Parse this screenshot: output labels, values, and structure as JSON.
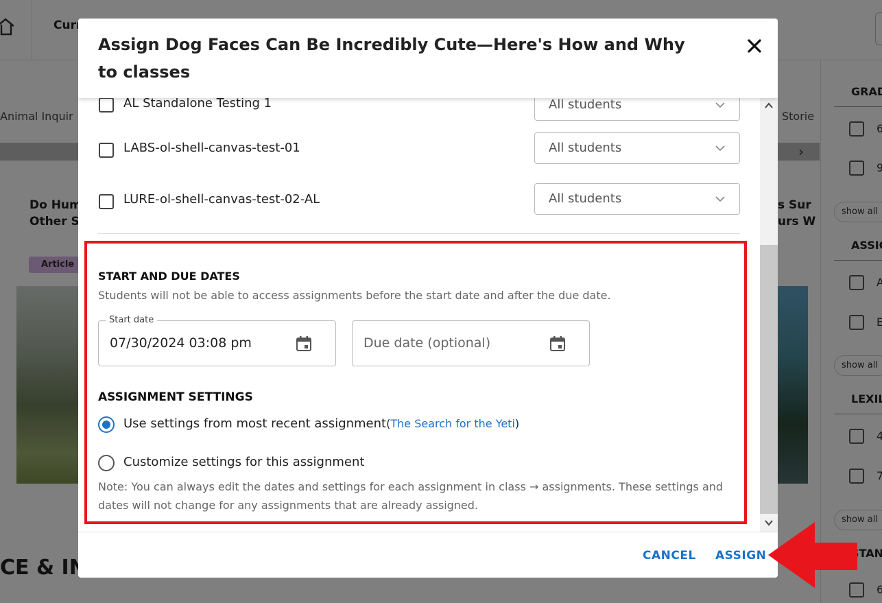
{
  "background": {
    "nav_current": "Curr",
    "tabs_left": "Animal Inquir",
    "tabs_right": "Storie",
    "card_left_title_line1": "Do Hum",
    "card_left_title_line2": "Other S",
    "article_badge": "Article",
    "card_right_title_line1": "s Sur",
    "card_right_title_line2": "urs W",
    "bottom_heading": "CE & INN",
    "sidebar": {
      "grade_title": "GRAD",
      "grade_values": [
        "6",
        "9"
      ],
      "assign_title": "ASSIG",
      "assign_values": [
        "A",
        "E"
      ],
      "lexile_title": "LEXIL",
      "lexile_values": [
        "4",
        "7"
      ],
      "standards_title": "STAN",
      "standards_values": [
        "6"
      ],
      "show_all": "show all"
    }
  },
  "modal": {
    "title": "Assign Dog Faces Can Be Incredibly Cute—Here's How and Why to classes",
    "classes": [
      {
        "name": "AL Standalone Testing 1",
        "students": "All students"
      },
      {
        "name": "LABS-ol-shell-canvas-test-01",
        "students": "All students"
      },
      {
        "name": "LURE-ol-shell-canvas-test-02-AL",
        "students": "All students"
      }
    ],
    "dates": {
      "heading": "START AND DUE DATES",
      "description": "Students will not be able to access assignments before the start date and after the due date.",
      "start_label": "Start date",
      "start_value": "07/30/2024 03:08 pm",
      "due_placeholder": "Due date (optional)"
    },
    "settings": {
      "heading": "ASSIGNMENT SETTINGS",
      "option_recent": "Use settings from most recent assignment",
      "recent_link_open": "(",
      "recent_link": "The Search for the Yeti",
      "recent_link_close": ")",
      "option_custom": "Customize settings for this assignment",
      "selected": "recent"
    },
    "note": "Note: You can always edit the dates and settings for each assignment in class → assignments. These settings and dates will not change for any assignments that are already assigned.",
    "cancel_label": "CANCEL",
    "assign_label": "ASSIGN"
  },
  "colors": {
    "accent": "#1a73c9",
    "highlight": "#e8161c",
    "overlay": "rgba(0,0,0,0.5)"
  },
  "icons": [
    "home-icon",
    "close-icon",
    "chevron-down-icon",
    "calendar-icon",
    "chevron-up-icon",
    "chevron-right-icon",
    "arrow-left-icon"
  ]
}
